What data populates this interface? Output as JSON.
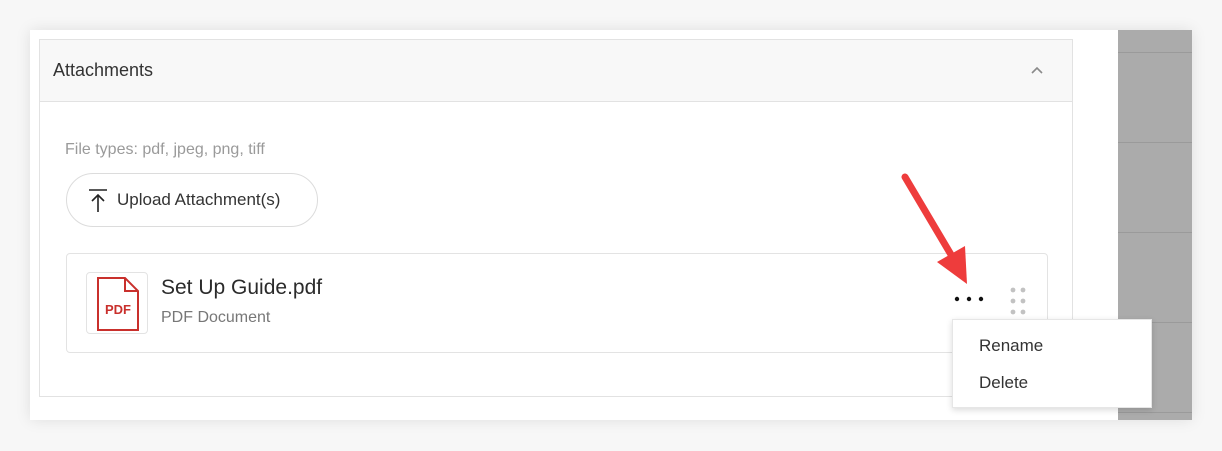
{
  "panel": {
    "title": "Attachments",
    "collapse_icon": "chevron-up-icon"
  },
  "uploader": {
    "file_types_hint": "File types: pdf, jpeg, png, tiff",
    "upload_label": "Upload Attachment(s)",
    "upload_icon": "upload-icon"
  },
  "attachment": {
    "thumb_label": "PDF",
    "name": "Set Up Guide.pdf",
    "type": "PDF Document",
    "actions_icon": "more-horizontal-icon",
    "drag_icon": "drag-handle-icon"
  },
  "context_menu": {
    "items": [
      {
        "label": "Rename"
      },
      {
        "label": "Delete"
      }
    ]
  },
  "annotation": {
    "arrow_color": "#ee3c3c"
  },
  "colors": {
    "pdf_red": "#c9302c",
    "sidebar_gray": "#ababab"
  }
}
